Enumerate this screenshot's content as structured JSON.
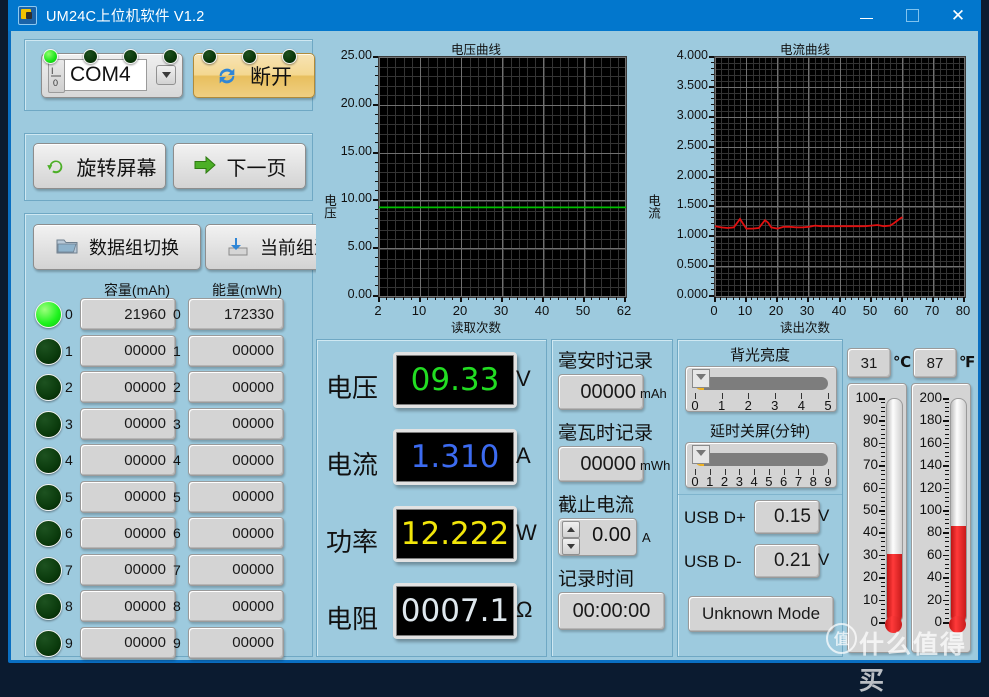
{
  "window": {
    "title": "UM24C上位机软件 V1.2",
    "icon": "app-icon",
    "minimize": "–",
    "maximize": "□",
    "close": "✕"
  },
  "connection": {
    "port_label": "I/O",
    "port_value": "COM4",
    "dropdown_icon": "chevron-down-icon",
    "disconnect_label": "断开",
    "disconnect_icon": "refresh-icon"
  },
  "status_leds": [
    {
      "on": true
    },
    {
      "on": false
    },
    {
      "on": false
    },
    {
      "on": false
    },
    {
      "on": false
    },
    {
      "on": false
    },
    {
      "on": false
    }
  ],
  "actions": {
    "rotate_screen": "旋转屏幕",
    "rotate_icon": "rotate-arrow-icon",
    "next_page": "下一页",
    "next_icon": "right-arrow-icon",
    "group_switch": "数据组切换",
    "group_switch_icon": "folder-icon",
    "group_clear": "当前组清零",
    "group_clear_icon": "save-icon"
  },
  "groups": {
    "capacity_header": "容量(mAh)",
    "energy_header": "能量(mWh)",
    "rows": [
      {
        "index": "0",
        "active": true,
        "capacity": "21960",
        "energy": "172330"
      },
      {
        "index": "1",
        "active": false,
        "capacity": "00000",
        "energy": "00000"
      },
      {
        "index": "2",
        "active": false,
        "capacity": "00000",
        "energy": "00000"
      },
      {
        "index": "3",
        "active": false,
        "capacity": "00000",
        "energy": "00000"
      },
      {
        "index": "4",
        "active": false,
        "capacity": "00000",
        "energy": "00000"
      },
      {
        "index": "5",
        "active": false,
        "capacity": "00000",
        "energy": "00000"
      },
      {
        "index": "6",
        "active": false,
        "capacity": "00000",
        "energy": "00000"
      },
      {
        "index": "7",
        "active": false,
        "capacity": "00000",
        "energy": "00000"
      },
      {
        "index": "8",
        "active": false,
        "capacity": "00000",
        "energy": "00000"
      },
      {
        "index": "9",
        "active": false,
        "capacity": "00000",
        "energy": "00000"
      }
    ]
  },
  "chart_data": [
    {
      "type": "line",
      "name": "voltage-chart",
      "title": "电压曲线",
      "xlabel": "读取次数",
      "ylabel": "电压",
      "ylim": [
        0.0,
        25.0
      ],
      "xlim": [
        2,
        62
      ],
      "yticks": [
        "25.00",
        "20.00",
        "15.00",
        "10.00",
        "5.00",
        "0.00"
      ],
      "xticks": [
        "2",
        "10",
        "20",
        "30",
        "40",
        "50",
        "62"
      ],
      "grid": true,
      "line_color": "#00c000",
      "background": "#000000",
      "series": [
        {
          "name": "电压",
          "color": "#00c000",
          "x": [
            2,
            6,
            10,
            14,
            18,
            22,
            26,
            30,
            34,
            38,
            42,
            46,
            50,
            54,
            58,
            62
          ],
          "values": [
            9.33,
            9.33,
            9.33,
            9.33,
            9.33,
            9.33,
            9.33,
            9.33,
            9.33,
            9.33,
            9.33,
            9.33,
            9.33,
            9.33,
            9.33,
            9.33
          ]
        }
      ]
    },
    {
      "type": "line",
      "name": "current-chart",
      "title": "电流曲线",
      "xlabel": "读出次数",
      "ylabel": "电流",
      "ylim": [
        0.0,
        4.0
      ],
      "xlim": [
        0,
        80
      ],
      "yticks": [
        "4.000",
        "3.500",
        "3.000",
        "2.500",
        "2.000",
        "1.500",
        "1.000",
        "0.500",
        "0.000"
      ],
      "xticks": [
        "0",
        "10",
        "20",
        "30",
        "40",
        "50",
        "60",
        "70",
        "80"
      ],
      "grid": true,
      "line_color": "#e01010",
      "background": "#000000",
      "series": [
        {
          "name": "电流",
          "color": "#e01010",
          "x": [
            0,
            2,
            4,
            6,
            8,
            9,
            10,
            12,
            14,
            16,
            17,
            18,
            20,
            22,
            24,
            26,
            28,
            30,
            32,
            34,
            36,
            38,
            40,
            42,
            44,
            46,
            48,
            50,
            52,
            54,
            56,
            57,
            58,
            59,
            60
          ],
          "values": [
            1.18,
            1.16,
            1.15,
            1.16,
            1.3,
            1.22,
            1.14,
            1.14,
            1.15,
            1.28,
            1.24,
            1.16,
            1.14,
            1.17,
            1.17,
            1.16,
            1.16,
            1.17,
            1.19,
            1.18,
            1.18,
            1.18,
            1.18,
            1.18,
            1.18,
            1.18,
            1.18,
            1.19,
            1.2,
            1.18,
            1.19,
            1.22,
            1.26,
            1.3,
            1.33
          ]
        }
      ]
    }
  ],
  "measurements": [
    {
      "label": "电压",
      "value": "09.33",
      "unit": "V",
      "color": "#22dd22"
    },
    {
      "label": "电流",
      "value": "1.310",
      "unit": "A",
      "color": "#3c6bf0"
    },
    {
      "label": "功率",
      "value": "12.222",
      "unit": "W",
      "color": "#f2e60a"
    },
    {
      "label": "电阻",
      "value": "0007.1",
      "unit": "Ω",
      "color": "#dfe8ee"
    }
  ],
  "records": {
    "mah_title": "毫安时记录",
    "mah_value": "00000",
    "mah_unit": "mAh",
    "mwh_title": "毫瓦时记录",
    "mwh_value": "00000",
    "mwh_unit": "mWh",
    "cutoff_title": "截止电流",
    "cutoff_value": "0.00",
    "cutoff_unit": "A",
    "cutoff_up_icon": "stepper-up-icon",
    "cutoff_down_icon": "stepper-down-icon",
    "time_title": "记录时间",
    "time_value": "00:00:00"
  },
  "settings": {
    "brightness_title": "背光亮度",
    "brightness_value": 0,
    "brightness_ticks": [
      "0",
      "1",
      "2",
      "3",
      "4",
      "5"
    ],
    "timeout_title": "延时关屏(分钟)",
    "timeout_value": 0,
    "timeout_ticks": [
      "0",
      "1",
      "2",
      "3",
      "4",
      "5",
      "6",
      "7",
      "8",
      "9"
    ],
    "usb_dp_label": "USB D+",
    "usb_dp_value": "0.15",
    "usb_dp_unit": "V",
    "usb_dn_label": "USB D-",
    "usb_dn_value": "0.21",
    "usb_dn_unit": "V",
    "mode": "Unknown Mode"
  },
  "temperature": {
    "celsius_value": "31",
    "celsius_unit": "℃",
    "fahrenheit_value": "87",
    "fahrenheit_unit": "℉",
    "celsius_scale": [
      "100",
      "90",
      "80",
      "70",
      "60",
      "50",
      "40",
      "30",
      "20",
      "10",
      "0"
    ],
    "fahrenheit_scale": [
      "200",
      "180",
      "160",
      "140",
      "120",
      "100",
      "80",
      "60",
      "40",
      "20",
      "0"
    ],
    "celsius_max": 100,
    "fahrenheit_max": 200
  },
  "watermark": {
    "badge": "值",
    "text": "什么值得买"
  }
}
